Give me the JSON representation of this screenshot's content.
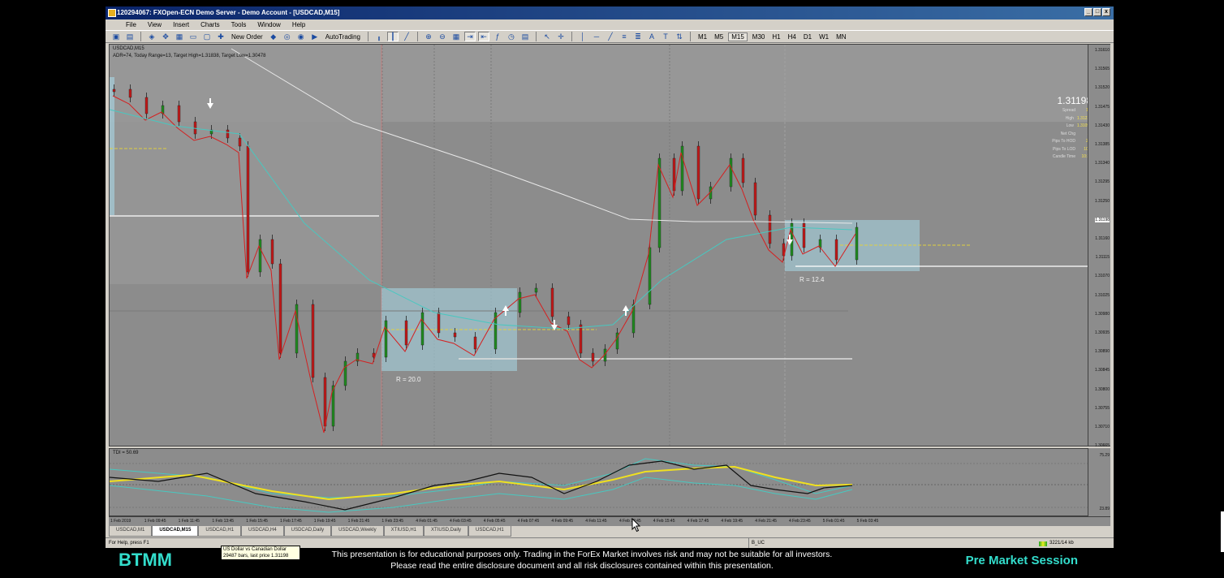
{
  "window": {
    "title": "120294067: FXOpen-ECN Demo Server - Demo Account - [USDCAD,M15]",
    "controls": [
      "_",
      "□",
      "x"
    ]
  },
  "menu": [
    "File",
    "View",
    "Insert",
    "Charts",
    "Tools",
    "Window",
    "Help"
  ],
  "toolbar": {
    "new_order_label": "New Order",
    "autotrading_label": "AutoTrading",
    "timeframes": [
      "M1",
      "M5",
      "M15",
      "M30",
      "H1",
      "H4",
      "D1",
      "W1",
      "MN"
    ],
    "active_timeframe": "M15"
  },
  "chart": {
    "symbol_label": "USDCAD,M15",
    "indicator_line": "ADR=74, Today Range=13, Target High=1.31838, Target Low=1.30478",
    "price_ticks": [
      "1.31610",
      "1.31565",
      "1.31520",
      "1.31475",
      "1.31430",
      "1.31385",
      "1.31340",
      "1.31295",
      "1.31250",
      "1.31198",
      "1.31160",
      "1.31115",
      "1.31070",
      "1.31025",
      "1.30980",
      "1.30935",
      "1.30890",
      "1.30845",
      "1.30800",
      "1.30755",
      "1.30710",
      "1.30665"
    ],
    "current_price_tag": "1.31198",
    "range_labels": [
      "R = 20.0",
      "R = 12.4"
    ],
    "corner_tag": "UC",
    "colors": {
      "background": "#8c8c8c",
      "bull": "#1f8a1f",
      "bear": "#c01818",
      "box": "#a8d8e8",
      "ema_fast": "#d42020",
      "ema_mid": "#48c8c0",
      "ema_slow": "#e8e8e8"
    }
  },
  "info_panel": {
    "price": "1.31198",
    "rows": [
      {
        "k": "Spread",
        "v": "1.4"
      },
      {
        "k": "High",
        "v": "1.31220"
      },
      {
        "k": "Low",
        "v": "1.31090"
      },
      {
        "k": "Net Chg",
        "v": "12"
      },
      {
        "k": "Pips To HOD",
        "v": "2.2"
      },
      {
        "k": "Pips To LOD",
        "v": "10.2"
      },
      {
        "k": "Candle Time",
        "v": "10:35"
      }
    ]
  },
  "indicator": {
    "label": "TDI = 50.69",
    "ticks": [
      "75.29",
      "23.89"
    ]
  },
  "time_axis": [
    "1 Feb 2019",
    "1 Feb 09:45",
    "1 Feb 11:45",
    "1 Feb 13:45",
    "1 Feb 15:45",
    "1 Feb 17:45",
    "1 Feb 19:45",
    "1 Feb 21:45",
    "1 Feb 23:45",
    "4 Feb 01:45",
    "4 Feb 03:45",
    "4 Feb 05:45",
    "4 Feb 07:45",
    "4 Feb 09:45",
    "4 Feb 11:45",
    "4 Feb 13:45",
    "4 Feb 15:45",
    "4 Feb 17:45",
    "4 Feb 19:45",
    "4 Feb 21:45",
    "4 Feb 23:45",
    "5 Feb 01:45",
    "5 Feb 03:45"
  ],
  "tabs": [
    "USDCAD,M1",
    "USDCAD,M15",
    "USDCAD,H1",
    "USDCAD,H4",
    "USDCAD,Daily",
    "USDCAD,Weekly",
    "XTIUSD,H1",
    "XTIUSD,Daily",
    "USDCAD,H1"
  ],
  "active_tab": 1,
  "status": {
    "help": "For Help, press F1",
    "profile": "B_UC",
    "traffic": "3221/14 kb"
  },
  "tooltip": {
    "line1": "US Dollar vs Canadian Dollar",
    "line2": "29487 bars, last price 1.31198"
  },
  "banner": {
    "brand": "BTMM",
    "disclaimer_line1": "This presentation is for educational purposes only.  Trading in the ForEx Market involves risk and may not be suitable for all investors.",
    "disclaimer_line2": "Please read the entire disclosure document and all risk disclosures contained within this presentation.",
    "session": "Pre Market Session"
  }
}
